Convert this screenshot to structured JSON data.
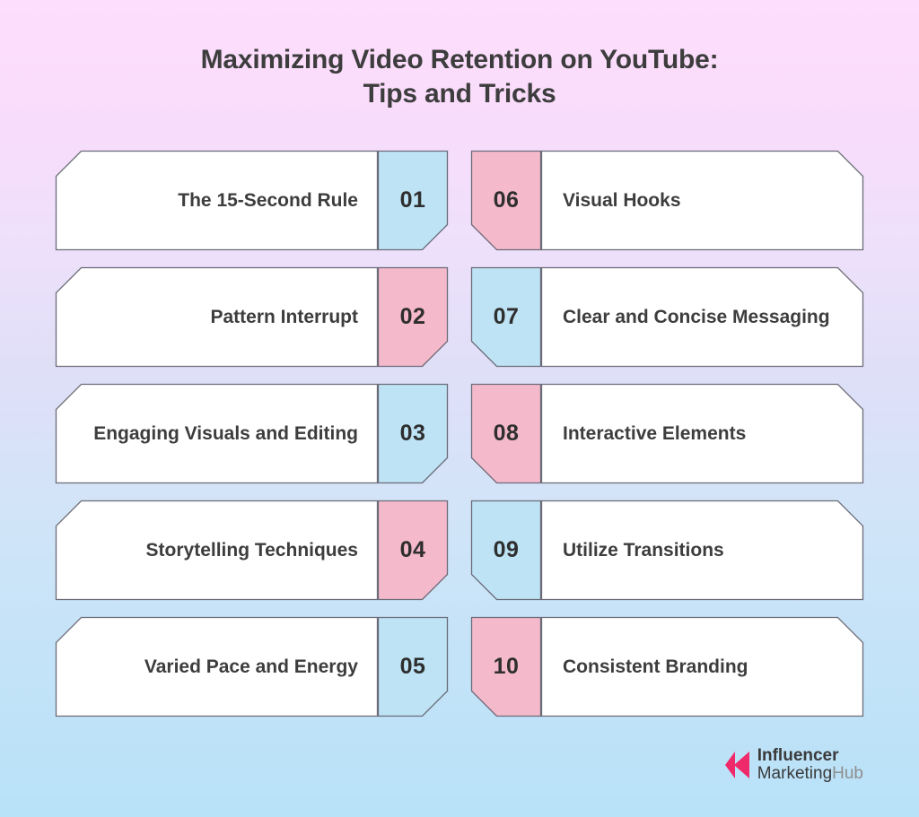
{
  "background": {
    "gradient_top": "#fddefc",
    "gradient_mid": "#dfdff8",
    "gradient_bottom": "#b8e2f8"
  },
  "title": {
    "line1": "Maximizing Video Retention on YouTube:",
    "line2": "Tips and Tricks",
    "color": "#3d3d3d"
  },
  "palette": {
    "blue": "#bde3f4",
    "pink": "#f5b9cc",
    "panel_white": "#ffffff",
    "outline": "#6b6b78",
    "text": "#3d3d3d",
    "logo_accent": "#ef2a6b"
  },
  "rows": [
    {
      "left": {
        "number": "01",
        "label": "The 15-Second Rule",
        "accent": "blue"
      },
      "right": {
        "number": "06",
        "label": "Visual Hooks",
        "accent": "pink"
      }
    },
    {
      "left": {
        "number": "02",
        "label": "Pattern Interrupt",
        "accent": "pink"
      },
      "right": {
        "number": "07",
        "label": "Clear and Concise Messaging",
        "accent": "blue"
      }
    },
    {
      "left": {
        "number": "03",
        "label": "Engaging Visuals and Editing",
        "accent": "blue"
      },
      "right": {
        "number": "08",
        "label": "Interactive Elements",
        "accent": "pink"
      }
    },
    {
      "left": {
        "number": "04",
        "label": "Storytelling Techniques",
        "accent": "pink"
      },
      "right": {
        "number": "09",
        "label": "Utilize Transitions",
        "accent": "blue"
      }
    },
    {
      "left": {
        "number": "05",
        "label": "Varied Pace and Energy",
        "accent": "blue"
      },
      "right": {
        "number": "10",
        "label": "Consistent Branding",
        "accent": "pink"
      }
    }
  ],
  "logo": {
    "line1": "Influencer",
    "line2_bold": "Marketing",
    "line2_light": "Hub",
    "mark": "left-arrow-icon"
  }
}
